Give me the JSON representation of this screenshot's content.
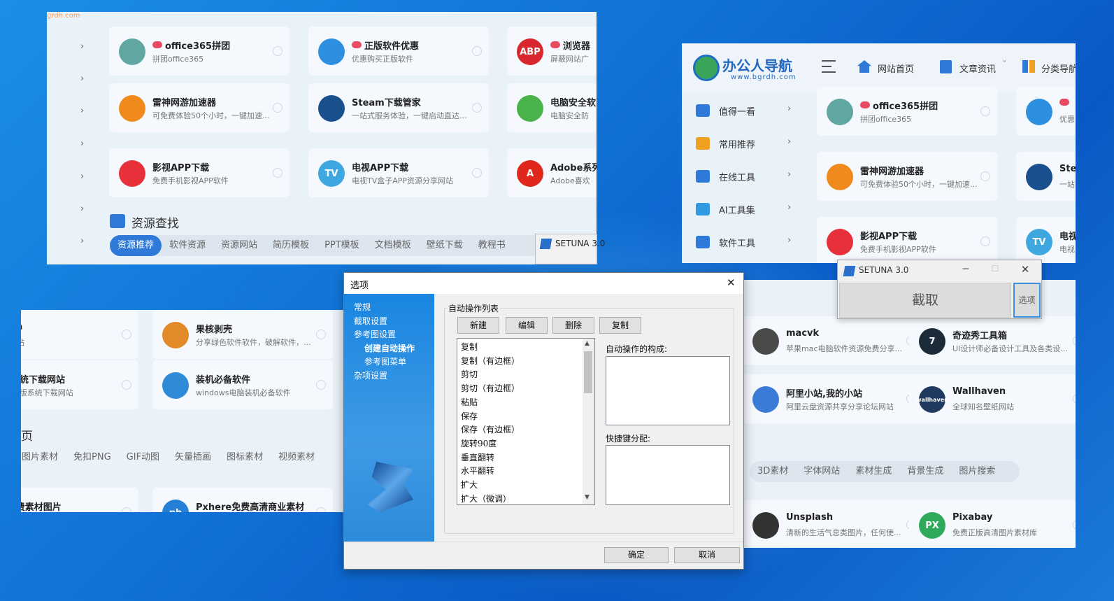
{
  "shot1": {
    "watermark": "grdh.com",
    "cards": [
      {
        "title": "office365拼团",
        "desc": "拼团office365",
        "hot": true,
        "color": "#5fa7a0"
      },
      {
        "title": "正版软件优惠",
        "desc": "优惠购买正版软件",
        "hot": true,
        "color": "#2c8fe0"
      },
      {
        "title": "浏览器",
        "desc": "屏蔽网站广",
        "hot": true,
        "color": "#d9262e",
        "icon_text": "ABP"
      },
      {
        "title": "雷神网游加速器",
        "desc": "可免费体验50个小时，一键加速...",
        "color": "#f08a1d"
      },
      {
        "title": "Steam下载管家",
        "desc": "一站式服务体验，一键启动直达...",
        "color": "#1a4f8e"
      },
      {
        "title": "电脑安全软",
        "desc": "电脑安全防",
        "color": "#49b34a"
      },
      {
        "title": "影视APP下载",
        "desc": "免费手机影视APP软件",
        "color": "#e8303b"
      },
      {
        "title": "电视APP下载",
        "desc": "电视TV盒子APP资源分享网站",
        "color": "#3fa7e0",
        "icon_text": "TV"
      },
      {
        "title": "Adobe系列",
        "desc": "Adobe喜欢",
        "color": "#e0271b",
        "icon_text": "A"
      }
    ],
    "section_title": "资源查找",
    "tabs": [
      "资源推荐",
      "软件资源",
      "资源网站",
      "简历模板",
      "PPT模板",
      "文档模板",
      "壁纸下载",
      "教程书"
    ]
  },
  "shot2": {
    "logo_name": "办公人导航",
    "logo_url": "www.bgrdh.com",
    "nav": [
      "网站首页",
      "文章资讯",
      "分类导航"
    ],
    "sidebar": [
      "值得一看",
      "常用推荐",
      "在线工具",
      "AI工具集",
      "软件工具"
    ],
    "cards": [
      {
        "title": "office365拼团",
        "desc": "拼团office365",
        "hot": true,
        "color": "#5fa7a0"
      },
      {
        "title": "",
        "desc": "优惠",
        "hot": true,
        "color": "#2c8fe0"
      },
      {
        "title": "雷神网游加速器",
        "desc": "可免费体验50个小时，一键加速...",
        "color": "#f08a1d"
      },
      {
        "title": "Ste",
        "desc": "一站",
        "color": "#1a4f8e"
      },
      {
        "title": "影视APP下载",
        "desc": "免费手机影视APP软件",
        "color": "#e8303b"
      },
      {
        "title": "电视",
        "desc": "电视",
        "color": "#3fa7e0",
        "icon_text": "TV"
      }
    ]
  },
  "shot3": {
    "cards": [
      {
        "title": "own",
        "desc": "件网站",
        "color": "#6b8fb5"
      },
      {
        "title": "果核剥壳",
        "desc": "分享绿色软件软件，破解软件，...",
        "color": "#e28a2a"
      },
      {
        "title": "版系统下载网站",
        "desc": "ws原版系统下载网站",
        "color": "#4d7bbf"
      },
      {
        "title": "装机必备软件",
        "desc": "windows电脑装机必备软件",
        "color": "#2f8ad8"
      },
      {
        "title": "s免费素材图片",
        "desc": "",
        "color": "#5a9fd8"
      },
      {
        "title": "Pxhere免费高清商业素材",
        "desc": "",
        "color": "#2580d6",
        "icon_text": "ph"
      }
    ],
    "section_title": "页",
    "tabs": [
      "图片素材",
      "免扣PNG",
      "GIF动图",
      "矢量插画",
      "图标素材",
      "视频素材"
    ]
  },
  "shot4": {
    "cards": [
      {
        "title": "macvk",
        "desc": "苹果mac电脑软件资源免费分享...",
        "color": "#4a4a4a"
      },
      {
        "title": "奇迹秀工具箱",
        "desc": "UI设计师必备设计工具及各类设...",
        "color": "#1c2b3a",
        "icon_text": "7"
      },
      {
        "title": "阿里小站,我的小站",
        "desc": "阿里云盘资源共享分享论坛网站",
        "color": "#3a7bd8"
      },
      {
        "title": "Wallhaven",
        "desc": "全球知名壁纸网站",
        "color": "#1f3a5e",
        "icon_text": "wallhaven"
      },
      {
        "title": "Unsplash",
        "desc": "清新的生活气息类图片，任何使...",
        "color": "#333333"
      },
      {
        "title": "Pixabay",
        "desc": "免费正版高清图片素材库",
        "color": "#2eaa5a",
        "icon_text": "PX"
      }
    ],
    "tabs": [
      "3D素材",
      "字体网站",
      "素材生成",
      "背景生成",
      "图片搜索"
    ]
  },
  "setuna_small": {
    "title": "SETUNA 3.0"
  },
  "setuna_main": {
    "title": "SETUNA 3.0",
    "capture_label": "截取",
    "options_label": "选项"
  },
  "options_dialog": {
    "title": "选项",
    "sidebar": [
      {
        "label": "常规",
        "indent": false
      },
      {
        "label": "截取设置",
        "indent": false
      },
      {
        "label": "参考图设置",
        "indent": false
      },
      {
        "label": "创建自动操作",
        "indent": true,
        "selected": true
      },
      {
        "label": "参考图菜单",
        "indent": true
      },
      {
        "label": "杂项设置",
        "indent": false
      }
    ],
    "group_label": "自动操作列表",
    "buttons": [
      "新建",
      "编辑",
      "删除",
      "复制"
    ],
    "actions": [
      "复制",
      "复制（有边框）",
      "剪切",
      "剪切（有边框）",
      "粘贴",
      "保存",
      "保存（有边框）",
      "旋转90度",
      "垂直翻转",
      "水平翻转",
      "扩大",
      "扩大（微调）"
    ],
    "composition_label": "自动操作的构成:",
    "shortcut_label": "快捷键分配:",
    "ok_label": "确定",
    "cancel_label": "取消"
  }
}
